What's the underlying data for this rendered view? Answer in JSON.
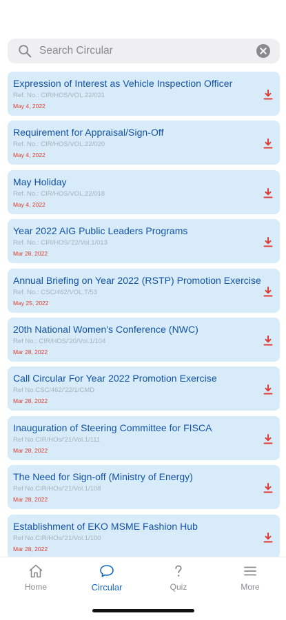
{
  "search": {
    "placeholder": "Search Circular"
  },
  "circulars": [
    {
      "title": "Expression of Interest as Vehicle Inspection Officer",
      "ref": "Ref. No.: CIR/HOS/VOL.22/021",
      "date": "May 4, 2022"
    },
    {
      "title": "Requirement for Appraisal/Sign-Off",
      "ref": "Ref. No.: CIR/HOS/VOL.22/020",
      "date": "May 4, 2022"
    },
    {
      "title": "May Holiday",
      "ref": "Ref. No.: CIR/HOS/VOL.22/018",
      "date": "May 4, 2022"
    },
    {
      "title": "Year 2022 AIG Public Leaders Programs",
      "ref": "Ref. No.: CIR/HOS/'22/Vol.1/013",
      "date": "Mar 28, 2022"
    },
    {
      "title": "Annual Briefing on Year 2022 (RSTP) Promotion Exercise",
      "ref": "Ref. No.: CSC/462/VOL.T/53",
      "date": "May 25, 2022"
    },
    {
      "title": "20th National Women's Conference (NWC)",
      "ref": "Ref No.: CIR/HOS/'20/Vol.1/104",
      "date": "Mar 28, 2022"
    },
    {
      "title": "Call Circular For Year 2022 Promotion Exercise",
      "ref": "Ref No.CSC/462/'22/1/CMD",
      "date": "Mar 28, 2022"
    },
    {
      "title": "Inauguration of Steering Committee for FISCA",
      "ref": "Ref No.CIR/HOs/'21/Vol.1/111",
      "date": "Mar 28, 2022"
    },
    {
      "title": "The Need for Sign-off (Ministry of Energy)",
      "ref": "Ref No.CIR/HOs/'21/Vol.1/108",
      "date": "Mar 28, 2022"
    },
    {
      "title": "Establishment of EKO MSME Fashion Hub",
      "ref": "Ref No.CIR/HOs/'21/Vol.1/100",
      "date": "Mar 28, 2022"
    }
  ],
  "tabs": [
    {
      "label": "Home",
      "icon": "home-icon",
      "active": false
    },
    {
      "label": "Circular",
      "icon": "chat-bubble-icon",
      "active": true
    },
    {
      "label": "Quiz",
      "icon": "question-icon",
      "active": false
    },
    {
      "label": "More",
      "icon": "menu-icon",
      "active": false
    }
  ],
  "colors": {
    "card_background": "#d7ecf8",
    "title": "#1350a8",
    "date": "#e23a2e",
    "download": "#e53935",
    "active_tab": "#1565c0",
    "inactive_tab": "#8a8a8e"
  }
}
